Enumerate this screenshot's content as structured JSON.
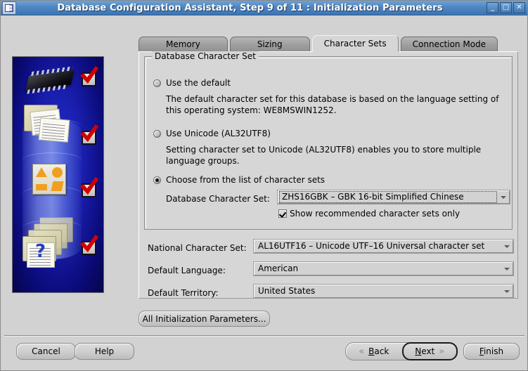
{
  "window": {
    "title": "Database Configuration Assistant, Step 9 of 11 : Initialization Parameters",
    "icon": "dbca-app-icon",
    "controls": {
      "minimize": "_",
      "maximize": "□",
      "close": "✕"
    },
    "accent_title_color": "#4f86c2",
    "background_color": "#d2d2d2"
  },
  "sidebar": {
    "name": "dbca-illustration",
    "background_color": "#1a1fb0"
  },
  "tabs": [
    {
      "label": "Memory",
      "active": false
    },
    {
      "label": "Sizing",
      "active": false
    },
    {
      "label": "Character Sets",
      "active": true
    },
    {
      "label": "Connection Mode",
      "active": false
    }
  ],
  "groupbox": {
    "title": "Database Character Set",
    "options": [
      {
        "label": "Use the default",
        "selected": false,
        "description": "The default character set for this database is based on the language setting of this operating system: WE8MSWIN1252."
      },
      {
        "label": "Use Unicode (AL32UTF8)",
        "selected": false,
        "description": "Setting character set to Unicode (AL32UTF8) enables you to store multiple language groups."
      },
      {
        "label": "Choose from the list of character sets",
        "selected": true,
        "description": ""
      }
    ],
    "database_charset": {
      "label": "Database Character Set:",
      "value": "ZHS16GBK – GBK 16-bit Simplified Chinese",
      "focused": true
    },
    "recommended_only": {
      "label": "Show recommended character sets only",
      "checked": true
    }
  },
  "fields": [
    {
      "label": "National Character Set:",
      "value": "AL16UTF16 – Unicode UTF–16 Universal character set"
    },
    {
      "label": "Default Language:",
      "value": "American"
    },
    {
      "label": "Default Territory:",
      "value": "United States"
    }
  ],
  "buttons": {
    "all_params": "All Initialization Parameters...",
    "cancel": "Cancel",
    "help": "Help",
    "back": "Back",
    "back_mnemonic": "B",
    "next": "Next",
    "next_mnemonic": "N",
    "finish": "Finish",
    "finish_mnemonic": "F"
  }
}
